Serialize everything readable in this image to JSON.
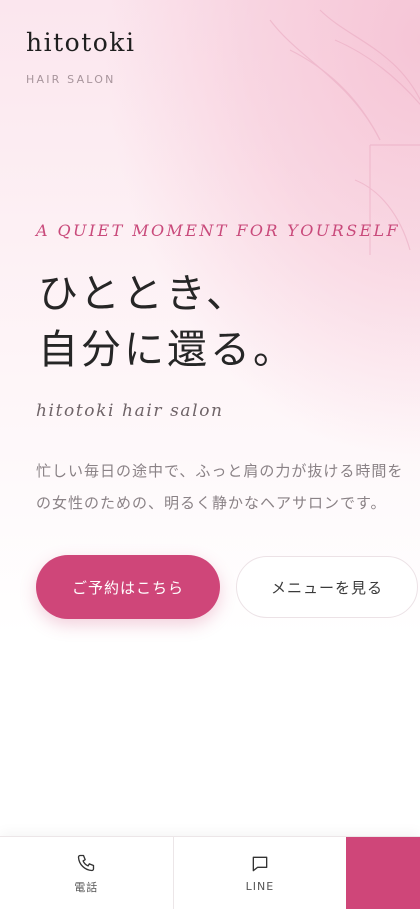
{
  "header": {
    "logo": "hitotoki",
    "subtitle": "HAIR SALON"
  },
  "hero": {
    "eyebrow": "A QUIET MOMENT FOR YOURSELF",
    "headline_line1": "ひととき、",
    "headline_line2": "自分に還る。",
    "en_subtitle": "hitotoki hair salon",
    "description_line1": "忙しい毎日の途中で、ふっと肩の力が抜ける時間を",
    "description_line2": "の女性のための、明るく静かなヘアサロンです。"
  },
  "buttons": {
    "reserve_label": "ご予約はこちら",
    "menu_label": "メニューを見る"
  },
  "bottom_bar": {
    "items": [
      {
        "label": "電話",
        "icon": "phone-icon"
      },
      {
        "label": "LINE",
        "icon": "chat-icon"
      }
    ]
  },
  "colors": {
    "accent": "#cf4679",
    "eyebrow": "#c94a7b",
    "background_tint": "#f6c5d6"
  }
}
